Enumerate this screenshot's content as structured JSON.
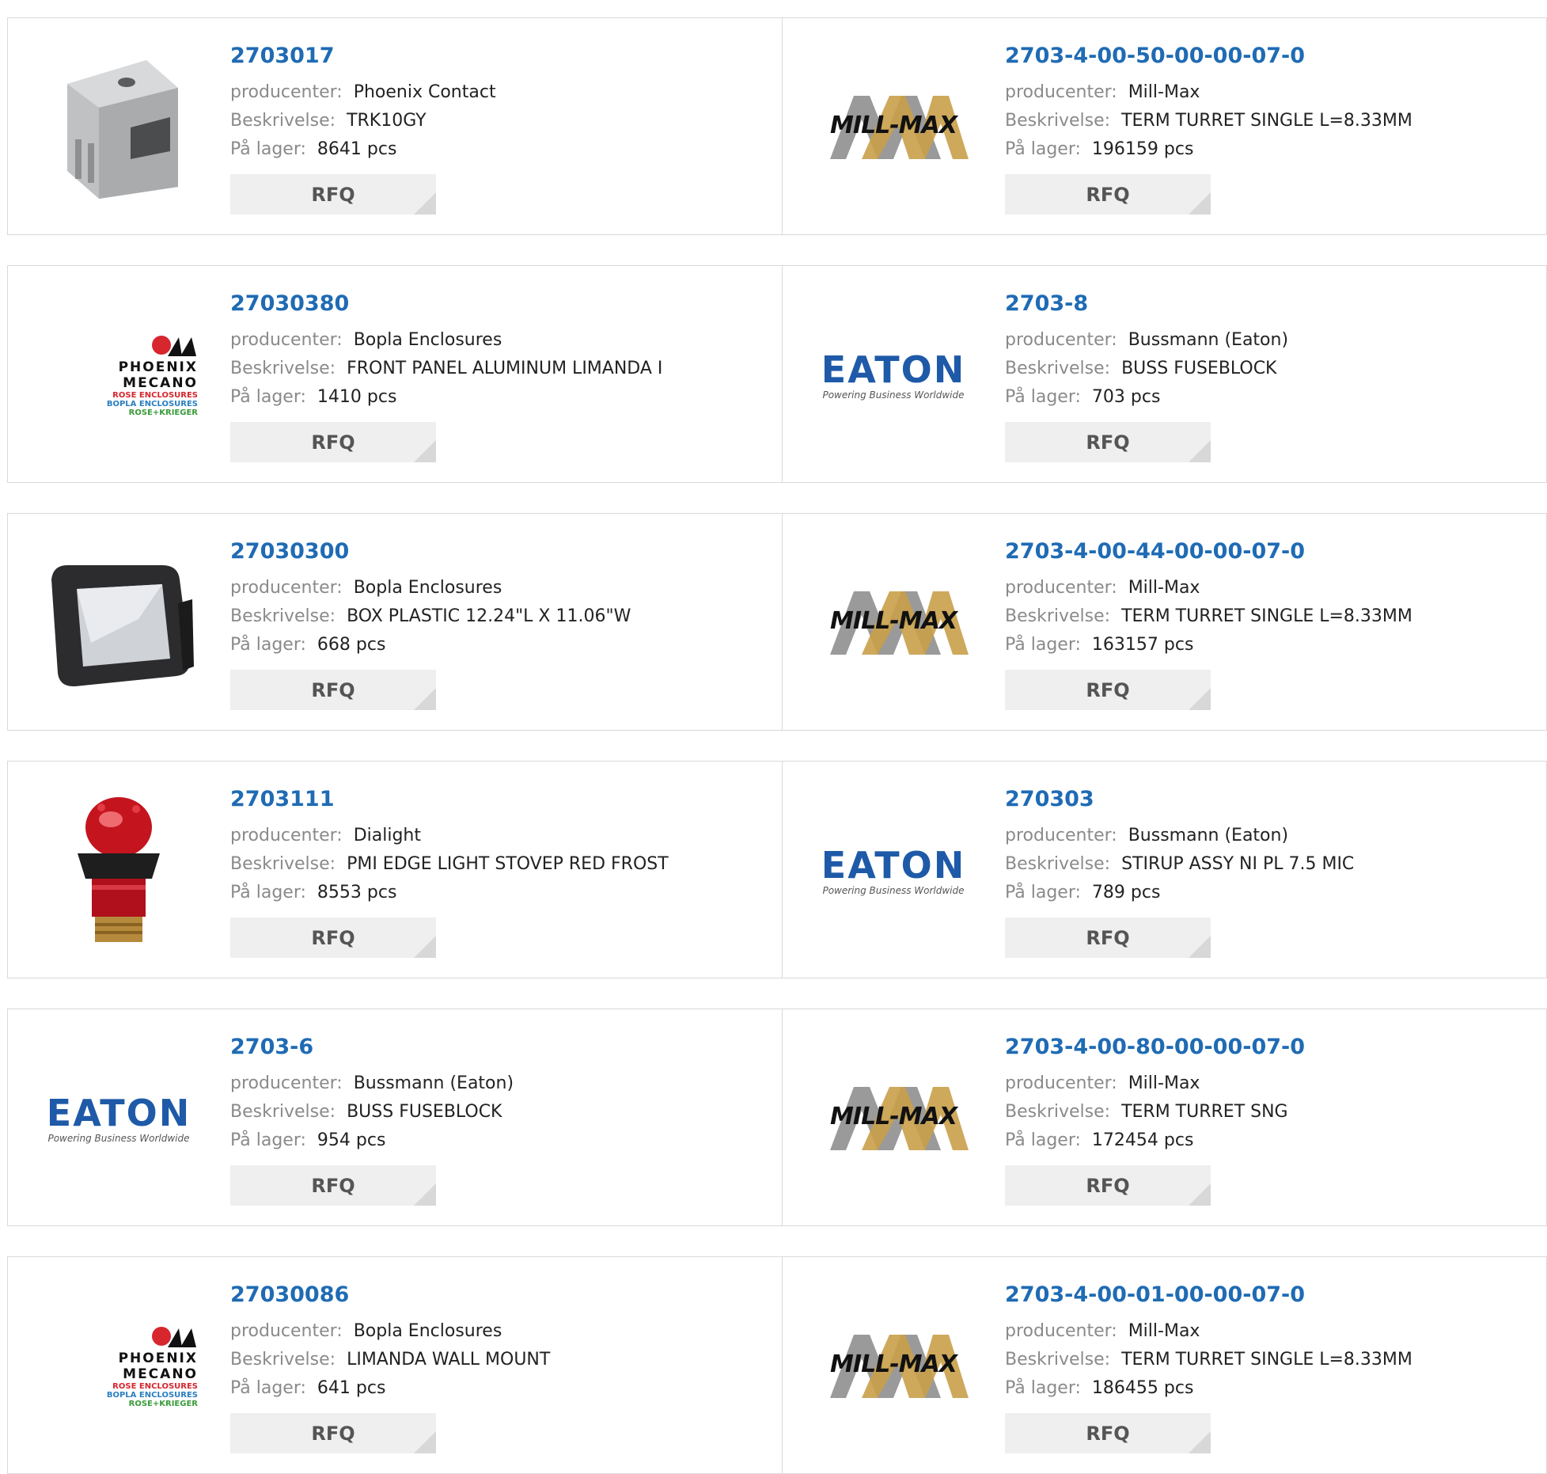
{
  "labels": {
    "manufacturer": "producenter:",
    "description": "Beskrivelse:",
    "stock": "På lager:",
    "rfq": "RFQ"
  },
  "brand_text": {
    "millmax": "MILL-MAX",
    "eaton": "EATON",
    "eaton_tagline": "Powering Business Worldwide",
    "phoenix": "PHOENIX MECANO",
    "phoenix_l1": "ROSE ENCLOSURES",
    "phoenix_l2": "BOPLA ENCLOSURES",
    "phoenix_l3": "ROSE+KRIEGER"
  },
  "colors": {
    "link": "#1f6bb4",
    "eaton_blue": "#1e5aa8",
    "phoenix_red": "#d7262e"
  },
  "rows": [
    {
      "left": {
        "part": "2703017",
        "manufacturer": "Phoenix Contact",
        "description": "TRK10GY",
        "stock": "8641 pcs",
        "image": "gray-terminal-block"
      },
      "right": {
        "part": "2703-4-00-50-00-00-07-0",
        "manufacturer": "Mill-Max",
        "description": "TERM TURRET SINGLE L=8.33MM",
        "stock": "196159 pcs",
        "image": "mill-max-logo"
      }
    },
    {
      "left": {
        "part": "27030380",
        "manufacturer": "Bopla Enclosures",
        "description": "FRONT PANEL ALUMINUM LIMANDA I",
        "stock": "1410 pcs",
        "image": "phoenix-mecano-logo"
      },
      "right": {
        "part": "2703-8",
        "manufacturer": "Bussmann (Eaton)",
        "description": "BUSS FUSEBLOCK",
        "stock": "703 pcs",
        "image": "eaton-logo"
      }
    },
    {
      "left": {
        "part": "27030300",
        "manufacturer": "Bopla Enclosures",
        "description": "BOX PLASTIC 12.24\"L X 11.06\"W",
        "stock": "668 pcs",
        "image": "plastic-box-enclosure"
      },
      "right": {
        "part": "2703-4-00-44-00-00-07-0",
        "manufacturer": "Mill-Max",
        "description": "TERM TURRET SINGLE L=8.33MM",
        "stock": "163157 pcs",
        "image": "mill-max-logo"
      }
    },
    {
      "left": {
        "part": "2703111",
        "manufacturer": "Dialight",
        "description": "PMI EDGE LIGHT STOVEP RED FROST",
        "stock": "8553 pcs",
        "image": "red-indicator-light"
      },
      "right": {
        "part": "270303",
        "manufacturer": "Bussmann (Eaton)",
        "description": "STIRUP ASSY NI PL 7.5 MIC",
        "stock": "789 pcs",
        "image": "eaton-logo"
      }
    },
    {
      "left": {
        "part": "2703-6",
        "manufacturer": "Bussmann (Eaton)",
        "description": "BUSS FUSEBLOCK",
        "stock": "954 pcs",
        "image": "eaton-logo"
      },
      "right": {
        "part": "2703-4-00-80-00-00-07-0",
        "manufacturer": "Mill-Max",
        "description": "TERM TURRET SNG",
        "stock": "172454 pcs",
        "image": "mill-max-logo"
      }
    },
    {
      "left": {
        "part": "27030086",
        "manufacturer": "Bopla Enclosures",
        "description": "LIMANDA WALL MOUNT",
        "stock": "641 pcs",
        "image": "phoenix-mecano-logo"
      },
      "right": {
        "part": "2703-4-00-01-00-00-07-0",
        "manufacturer": "Mill-Max",
        "description": "TERM TURRET SINGLE L=8.33MM",
        "stock": "186455 pcs",
        "image": "mill-max-logo"
      }
    }
  ]
}
